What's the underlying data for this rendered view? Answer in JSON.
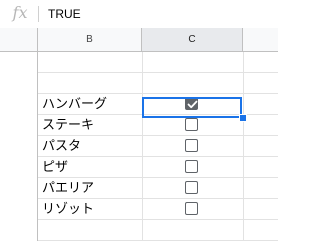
{
  "formula_bar": {
    "fx_symbol": "fx",
    "value": "TRUE"
  },
  "columns": {
    "b_label": "B",
    "c_label": "C"
  },
  "rows": [
    {
      "label": "",
      "checked": null
    },
    {
      "label": "",
      "checked": null
    },
    {
      "label": "ハンバーグ",
      "checked": true
    },
    {
      "label": "ステーキ",
      "checked": false
    },
    {
      "label": "パスタ",
      "checked": false
    },
    {
      "label": "ピザ",
      "checked": false
    },
    {
      "label": "パエリア",
      "checked": false
    },
    {
      "label": "リゾット",
      "checked": false
    },
    {
      "label": "",
      "checked": null
    }
  ],
  "colors": {
    "selection": "#1a73e8",
    "checkbox": "#5f6368"
  }
}
